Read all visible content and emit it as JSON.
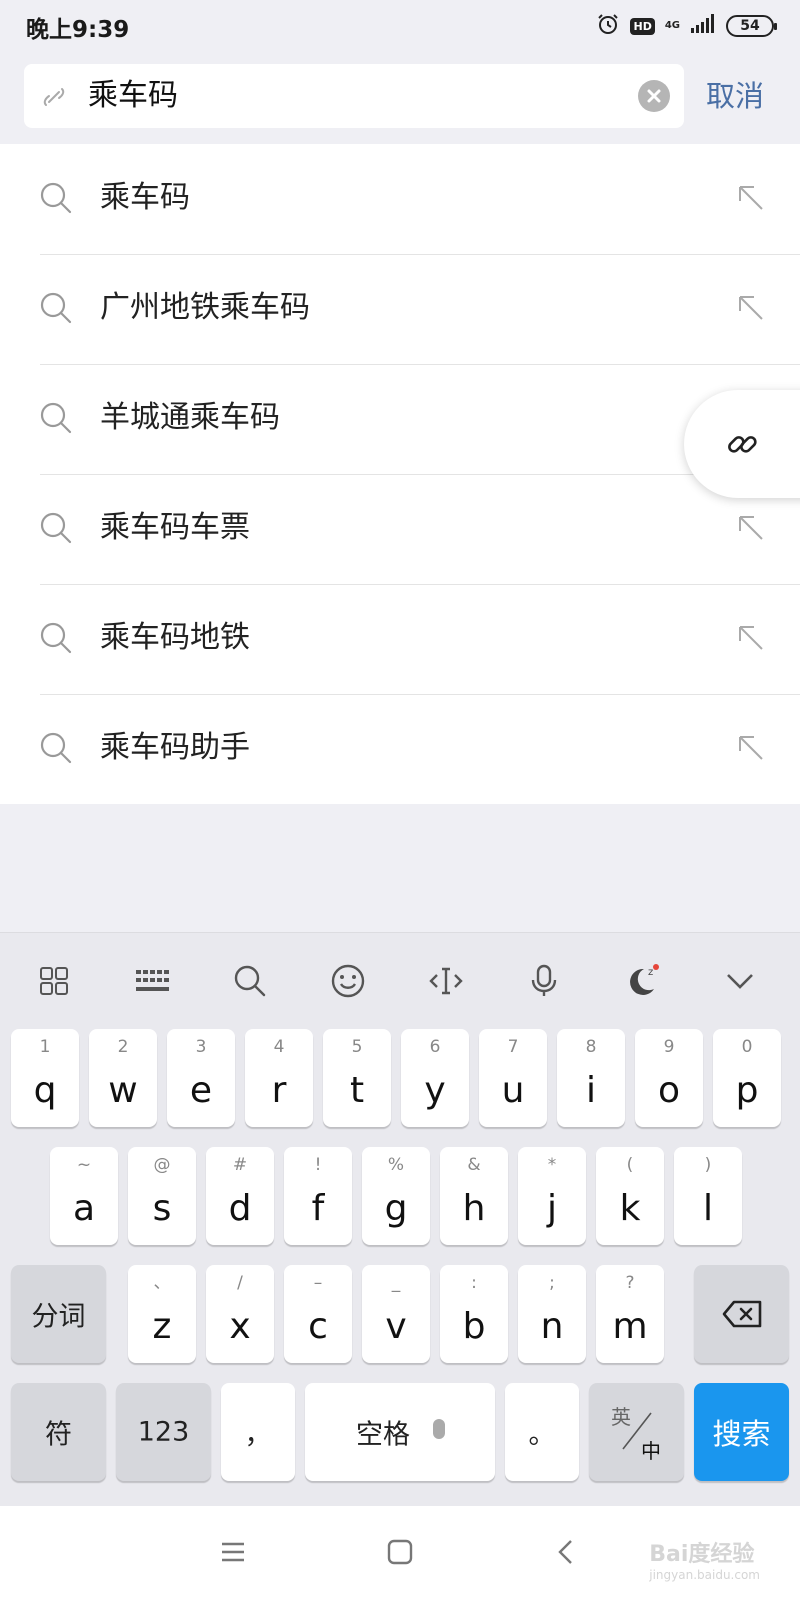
{
  "status_bar": {
    "time": "晚上9:39",
    "hd": "HD",
    "network": "4G",
    "battery": "54"
  },
  "search": {
    "query": "乘车码",
    "cancel_label": "取消"
  },
  "suggestions": [
    {
      "text": "乘车码"
    },
    {
      "text": "广州地铁乘车码"
    },
    {
      "text": "羊城通乘车码"
    },
    {
      "text": "乘车码车票"
    },
    {
      "text": "乘车码地铁"
    },
    {
      "text": "乘车码助手"
    }
  ],
  "keyboard": {
    "row1": [
      {
        "main": "q",
        "sub": "1"
      },
      {
        "main": "w",
        "sub": "2"
      },
      {
        "main": "e",
        "sub": "3"
      },
      {
        "main": "r",
        "sub": "4"
      },
      {
        "main": "t",
        "sub": "5"
      },
      {
        "main": "y",
        "sub": "6"
      },
      {
        "main": "u",
        "sub": "7"
      },
      {
        "main": "i",
        "sub": "8"
      },
      {
        "main": "o",
        "sub": "9"
      },
      {
        "main": "p",
        "sub": "0"
      }
    ],
    "row2": [
      {
        "main": "a",
        "sub": "~"
      },
      {
        "main": "s",
        "sub": "@"
      },
      {
        "main": "d",
        "sub": "#"
      },
      {
        "main": "f",
        "sub": "!"
      },
      {
        "main": "g",
        "sub": "%"
      },
      {
        "main": "h",
        "sub": "&"
      },
      {
        "main": "j",
        "sub": "*"
      },
      {
        "main": "k",
        "sub": "("
      },
      {
        "main": "l",
        "sub": ")"
      }
    ],
    "row3": [
      {
        "main": "z",
        "sub": "、"
      },
      {
        "main": "x",
        "sub": "/"
      },
      {
        "main": "c",
        "sub": "–"
      },
      {
        "main": "v",
        "sub": "_"
      },
      {
        "main": "b",
        "sub": ":"
      },
      {
        "main": "n",
        "sub": ";"
      },
      {
        "main": "m",
        "sub": "?"
      }
    ],
    "fenci": "分词",
    "fu": "符",
    "num": "123",
    "comma": "，",
    "space": "空格",
    "period": "。",
    "lang_top": "英",
    "lang_bottom": "中",
    "search": "搜索"
  },
  "watermark": {
    "brand": "Bai度经验",
    "url": "jingyan.baidu.com"
  },
  "colors": {
    "accent_blue": "#1a96ee",
    "cancel_link": "#4a6fa5",
    "background": "#efeff4"
  }
}
